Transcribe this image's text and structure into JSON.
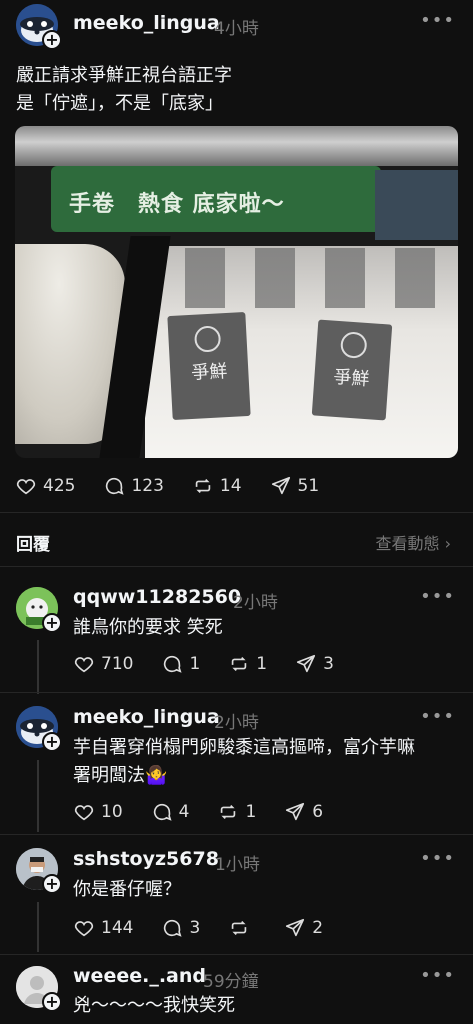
{
  "post": {
    "username": "meeko_lingua",
    "time": "4小時",
    "text_line1": "嚴正請求爭鮮正視台語正字",
    "text_line2": "是「佇遮」，不是「底家」",
    "sign_text": "手卷　熱食 底家啦～",
    "tag_text": "爭鮮",
    "likes": "425",
    "comments": "123",
    "reposts": "14",
    "shares": "51"
  },
  "replies_header": {
    "label": "回覆",
    "view_activity": "查看動態 ›"
  },
  "replies": [
    {
      "username": "qqww11282560",
      "time": "2小時",
      "text": "誰鳥你的要求 笑死",
      "likes": "710",
      "comments": "1",
      "reposts": "1",
      "shares": "3"
    },
    {
      "username": "meeko_lingua",
      "time": "2小時",
      "text_line1": "芋自署穿俏榻門卵駿黍這高摳啼，富介芋嘛",
      "text_line2": "署明闆法🤷‍♀️",
      "likes": "10",
      "comments": "4",
      "reposts": "1",
      "shares": "6"
    },
    {
      "username": "sshstoyz5678",
      "time": "1小時",
      "text": "你是番仔喔？",
      "likes": "144",
      "comments": "3",
      "reposts": "",
      "shares": "2"
    },
    {
      "username": "weeee._.and",
      "time": "59分鐘",
      "text": "兇～～～～我快笑死"
    }
  ],
  "colors": {
    "background": "#101010",
    "text": "#f3f5f7",
    "muted": "#777777",
    "sign_green": "#2e6b3c"
  },
  "icons": [
    "heart-icon",
    "comment-icon",
    "repost-icon",
    "share-icon",
    "more-icon",
    "plus-icon",
    "chevron-right-icon"
  ]
}
